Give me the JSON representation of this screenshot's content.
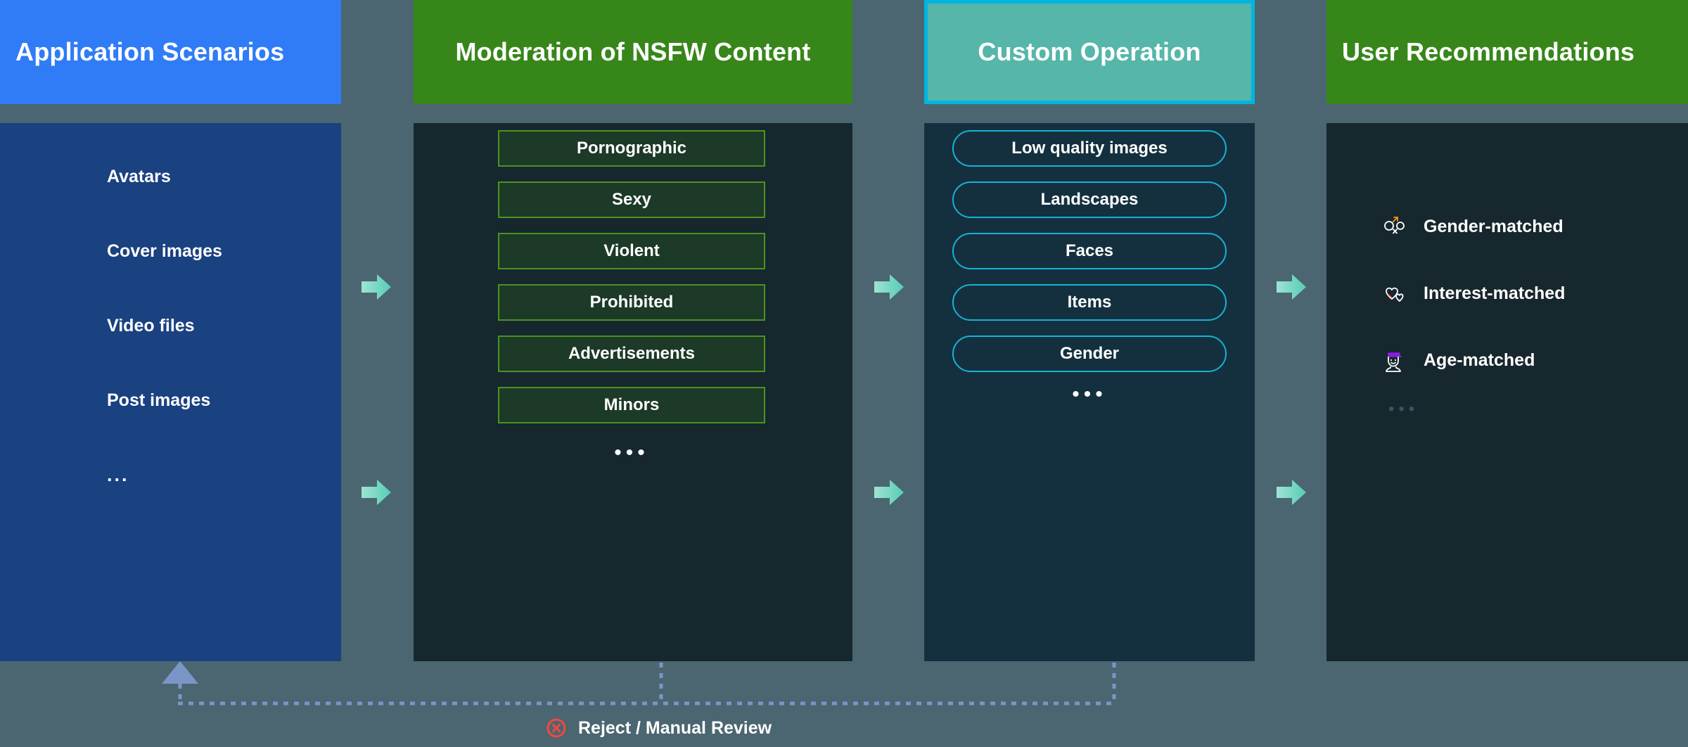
{
  "columns": [
    {
      "header": "Application Scenarios",
      "header_bg": "#2f7cf6",
      "body_bg": "#1a4180",
      "items": [
        "Avatars",
        "Cover images",
        "Video files",
        "Post images",
        "..."
      ]
    },
    {
      "header": "Moderation of NSFW Content",
      "header_bg": "#37861a",
      "body_bg": "#17272e",
      "box_border": "#4a9321",
      "box_fill": "#1c3a27",
      "items": [
        "Pornographic",
        "Sexy",
        "Violent",
        "Prohibited",
        "Advertisements",
        "Minors"
      ],
      "ellipsis": "•••"
    },
    {
      "header": "Custom Operation",
      "header_bg": "#55b6a9",
      "header_border": "#00b5e2",
      "body_bg": "#14303f",
      "pill_border": "#17b2d4",
      "items": [
        "Low quality images",
        "Landscapes",
        "Faces",
        "Items",
        "Gender"
      ],
      "ellipsis": "•••"
    },
    {
      "header": "User Recommendations",
      "header_bg": "#37861a",
      "body_bg": "#17272e",
      "items": [
        {
          "label": "Gender-matched",
          "icon": "gender-symbols-icon"
        },
        {
          "label": "Interest-matched",
          "icon": "hearts-icon"
        },
        {
          "label": "Age-matched",
          "icon": "person-cap-icon"
        }
      ],
      "ellipsis": "•••"
    }
  ],
  "arrows": {
    "color": "#6ed7c0",
    "count_per_gap": 2
  },
  "feedback": {
    "label": "Reject / Manual Review",
    "icon": "circle-x-icon",
    "icon_color": "#f4473f",
    "line_color": "#7a96c8"
  },
  "background_color": "#4b6670"
}
